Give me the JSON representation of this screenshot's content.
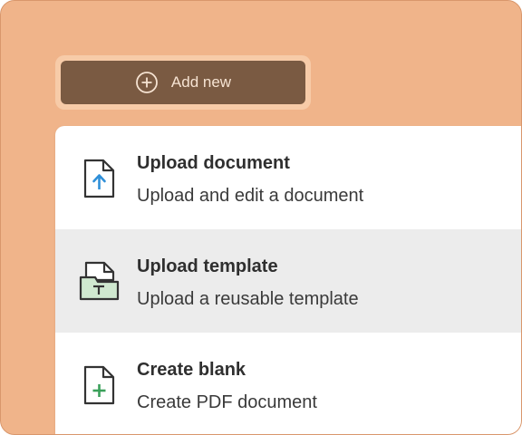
{
  "add_button": {
    "label": "Add new",
    "icon": "plus-circle-icon"
  },
  "menu": {
    "items": [
      {
        "title": "Upload document",
        "description": "Upload and edit a document",
        "icon": "upload-document-icon"
      },
      {
        "title": "Upload template",
        "description": "Upload a reusable template",
        "icon": "upload-template-icon",
        "highlighted": true
      },
      {
        "title": "Create blank",
        "description": "Create PDF document",
        "icon": "create-blank-icon"
      }
    ]
  },
  "colors": {
    "background": "#f0b48a",
    "button": "#7a5a42",
    "button_text": "#f6e3d2",
    "upload_arrow": "#2f8fd8",
    "template_fill": "#cfe8cf",
    "create_plus": "#3aa05a",
    "highlight_row": "#ececec"
  }
}
